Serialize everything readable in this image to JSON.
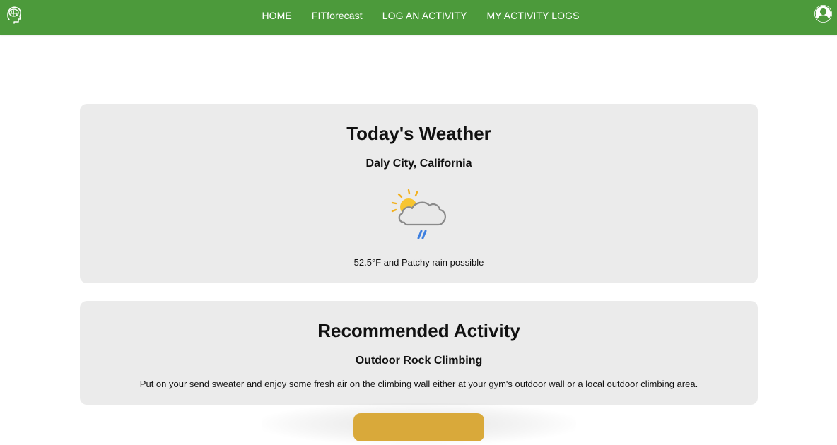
{
  "navbar": {
    "background": "#4c9a3b",
    "logo_icon": "brain-head-icon",
    "links": [
      {
        "label": "HOME"
      },
      {
        "label": "FITforecast"
      },
      {
        "label": "LOG AN ACTIVITY"
      },
      {
        "label": "MY ACTIVITY LOGS"
      }
    ],
    "profile_icon": "user-avatar-icon"
  },
  "weather": {
    "title": "Today's Weather",
    "location": "Daly City, California",
    "icon": "sun-cloud-rain-icon",
    "description": "52.5°F and Patchy rain possible"
  },
  "activity": {
    "title": "Recommended Activity",
    "name": "Outdoor Rock Climbing",
    "description": "Put on your send sweater and enjoy some fresh air on the climbing wall either at your gym's outdoor wall or a local outdoor climbing area.",
    "button_color": "#d9a93a"
  }
}
